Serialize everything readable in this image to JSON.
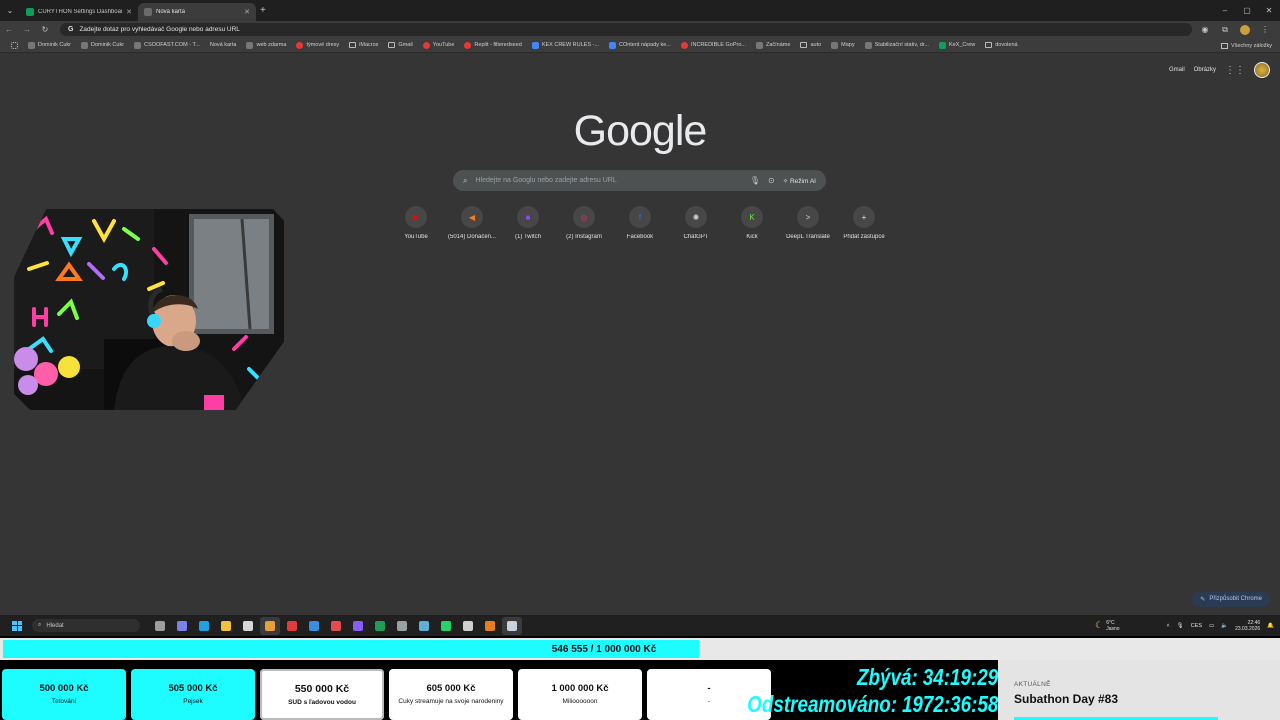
{
  "browser": {
    "tabs": [
      {
        "title": "CURYTHON Settings Dashboard",
        "active": false
      },
      {
        "title": "Nová karta",
        "active": true
      }
    ],
    "new_tab_glyph": "+",
    "window_controls": [
      "–",
      "▢",
      "✕"
    ],
    "omnibox_text": "Zadejte dotaz pro vyhledávač Google nebo adresu URL",
    "bookmarks": [
      {
        "label": "Dominik Cukr",
        "icon": "profile-icon"
      },
      {
        "label": "Dominik Cukr",
        "icon": "profile-icon"
      },
      {
        "label": "CSOOFAST.COM - T...",
        "icon": "link-icon"
      },
      {
        "label": "Nová karta",
        "icon": "none"
      },
      {
        "label": "web zdarma",
        "icon": "web-icon"
      },
      {
        "label": "týmové dresy",
        "icon": "red-icon"
      },
      {
        "label": "iMacros",
        "icon": "folder-icon"
      },
      {
        "label": "Gmail",
        "icon": "folder-icon"
      },
      {
        "label": "YouTube",
        "icon": "youtube-icon"
      },
      {
        "label": "Replit - filteredseed",
        "icon": "replit-icon"
      },
      {
        "label": "KEX CREW RULES -...",
        "icon": "blue-icon"
      },
      {
        "label": "COntent nápady ke...",
        "icon": "blue-icon"
      },
      {
        "label": "INCREDIBLE GoPro...",
        "icon": "youtube-icon"
      },
      {
        "label": "Začínáme",
        "icon": "globe-icon"
      },
      {
        "label": "auto",
        "icon": "folder-icon"
      },
      {
        "label": "Mapy",
        "icon": "map-icon"
      },
      {
        "label": "Stabilizační stativ, dr...",
        "icon": "web-icon"
      },
      {
        "label": "KeX_Crew",
        "icon": "sheets-icon"
      },
      {
        "label": "dovolená",
        "icon": "folder-icon"
      }
    ],
    "bookmarks_all": "Všechny záložky"
  },
  "ntp": {
    "top_links": [
      "Gmail",
      "Obrázky"
    ],
    "logo": "Google",
    "search_placeholder": "Hledejte na Googlu nebo zadejte adresu URL",
    "ai_mode": "Režim AI",
    "shortcuts": [
      {
        "label": "YouTube",
        "icon": "youtube-icon",
        "color": "#ff0000",
        "glyph": "▶"
      },
      {
        "label": "(5014) Donačen...",
        "icon": "donation-icon",
        "color": "#ff7a1a",
        "glyph": "◀"
      },
      {
        "label": "(1) Twitch",
        "icon": "twitch-icon",
        "color": "#9146ff",
        "glyph": "■"
      },
      {
        "label": "(2) Instagram",
        "icon": "instagram-icon",
        "color": "#e1306c",
        "glyph": "◎"
      },
      {
        "label": "Facebook",
        "icon": "facebook-icon",
        "color": "#1877f2",
        "glyph": "f"
      },
      {
        "label": "ChatGPT",
        "icon": "chatgpt-icon",
        "color": "#cfcfcf",
        "glyph": "✺"
      },
      {
        "label": "Kick",
        "icon": "kick-icon",
        "color": "#53fc18",
        "glyph": "K"
      },
      {
        "label": "DeepL Translate",
        "icon": "deepl-icon",
        "color": "#cfd8e6",
        "glyph": ">"
      },
      {
        "label": "Přidat zástupce",
        "icon": "add-icon",
        "color": "#e3e3e3",
        "glyph": "+"
      }
    ],
    "customize": "Přizpůsobit Chrome"
  },
  "taskbar": {
    "search_placeholder": "Hledat",
    "apps": [
      {
        "name": "task-view-icon",
        "color": "#9e9e9e",
        "active": false
      },
      {
        "name": "teams-icon",
        "color": "#7b83eb",
        "active": false
      },
      {
        "name": "edge-icon",
        "color": "#1fa2e3",
        "active": false
      },
      {
        "name": "explorer-icon",
        "color": "#f3c23c",
        "active": false
      },
      {
        "name": "store-icon",
        "color": "#d7d7d7",
        "active": false
      },
      {
        "name": "chrome-icon",
        "color": "#e8a13a",
        "active": true
      },
      {
        "name": "acrobat-icon",
        "color": "#e03a3a",
        "active": false
      },
      {
        "name": "shield-icon",
        "color": "#3a8ee0",
        "active": false
      },
      {
        "name": "app-red-icon",
        "color": "#e24c4c",
        "active": false
      },
      {
        "name": "app-purple-icon",
        "color": "#8a5cf6",
        "active": false
      },
      {
        "name": "excel-icon",
        "color": "#1f9d55",
        "active": false
      },
      {
        "name": "settings-icon",
        "color": "#9aa0a6",
        "active": false
      },
      {
        "name": "window-icon",
        "color": "#5fb0d8",
        "active": false
      },
      {
        "name": "whatsapp-icon",
        "color": "#25d366",
        "active": false
      },
      {
        "name": "terminal-icon",
        "color": "#cfcfcf",
        "active": false
      },
      {
        "name": "app-orange-icon",
        "color": "#e67e22",
        "active": false
      },
      {
        "name": "steam-icon",
        "color": "#c9d3e0",
        "active": true
      }
    ],
    "weather_temp": "6°C",
    "weather_desc": "Jasno",
    "lang": "CES",
    "time": "22:46",
    "date": "23.03.2026"
  },
  "overlay": {
    "goal_text": "546 555 / 1 000 000 Kč",
    "goal_progress": 0.5466,
    "milestones": [
      {
        "amount": "500 000 Kč",
        "desc": "Tetování",
        "state": "done"
      },
      {
        "amount": "505 000 Kč",
        "desc": "Pejsek",
        "state": "done"
      },
      {
        "amount": "550 000 Kč",
        "desc": "SUD s ľadovou vodou",
        "state": "current"
      },
      {
        "amount": "605 000 Kč",
        "desc": "Cuky streamuje na svoje narodeniny",
        "state": "todo"
      },
      {
        "amount": "1 000 000 Kč",
        "desc": "Milioooooon",
        "state": "todo"
      },
      {
        "amount": "-",
        "desc": "-",
        "state": "todo"
      }
    ],
    "remaining_label": "Zbývá:",
    "remaining_value": "34:19:29",
    "streamed_label": "Odstreamováno:",
    "streamed_value": "1972:36:58",
    "now_label": "AKTUÁLNĚ",
    "now_value": "Subathon Day #83",
    "accent": "#1dfcff"
  }
}
